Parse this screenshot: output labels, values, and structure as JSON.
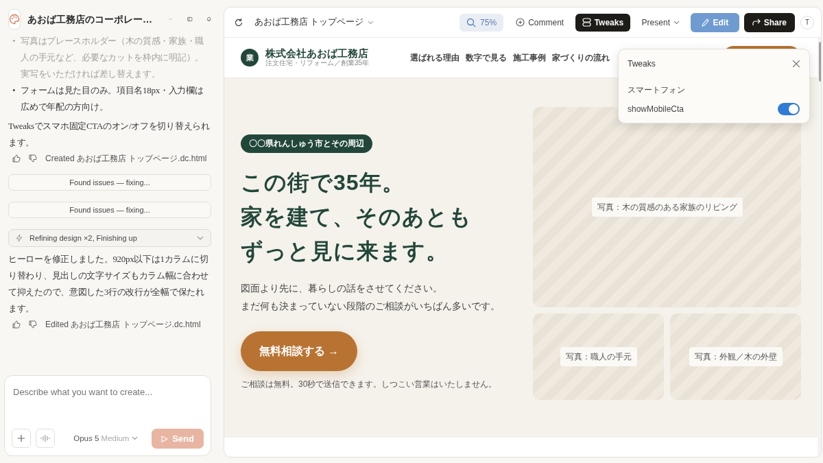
{
  "sidebar": {
    "project_title": "あおば工務店のコーポレー…",
    "messages": [
      {
        "kind": "bullets",
        "marker": "•",
        "items": [
          "写真はプレースホルダー（木の質感・家族・職人の手元など、必要なカットを枠内に明記）。実写をいただければ差し替えます。",
          "フォームは見た目のみ。項目名18px・入力欄は広めで年配の方向け。"
        ]
      },
      {
        "kind": "paragraph",
        "text": "Tweaksでスマホ固定CTAのオン/オフを切り替えられます。"
      },
      {
        "kind": "file",
        "text": "Created あおば工務店 トップページ.dc.html"
      },
      {
        "kind": "status",
        "text": "Found issues — fixing..."
      },
      {
        "kind": "status",
        "text": "Found issues — fixing..."
      },
      {
        "kind": "collapsible",
        "text": "Refining design ×2, Finishing up",
        "expanded": false
      },
      {
        "kind": "paragraph",
        "text": "ヒーローを修正しました。920px以下は1カラムに切り替わり、見出しの文字サイズもカラム幅に合わせて抑えたので、意図した3行の改行が全幅で保たれます。"
      },
      {
        "kind": "file",
        "text": "Edited あおば工務店 トップページ.dc.html"
      }
    ],
    "composer": {
      "placeholder": "Describe what you want to create...",
      "model": "Opus 5",
      "effort": "Medium",
      "send": "Send",
      "send_disabled": true
    }
  },
  "toolbar": {
    "page_title": "あおば工務店 トップページ",
    "zoom": "75%",
    "buttons": [
      {
        "kind": "comment",
        "label": "Comment"
      },
      {
        "kind": "tweaks",
        "label": "Tweaks",
        "selected": true
      },
      {
        "kind": "present",
        "label": "Present"
      },
      {
        "kind": "edit",
        "label": "Edit"
      },
      {
        "kind": "share",
        "label": "Share"
      }
    ],
    "avatar": "T"
  },
  "site": {
    "logo_mark": "業",
    "name": "株式会社あおば工務店",
    "tagline": "注文住宅・リフォーム／創業35年",
    "nav": [
      "選ばれる理由",
      "数字で見る",
      "施工事例",
      "家づくりの流れ"
    ],
    "hero": {
      "tag": "〇〇県れんしゅう市とその周辺",
      "headline": [
        "この街で35年。",
        "家を建て、そのあとも",
        "ずっと見に来ます。"
      ],
      "lead": [
        "図面より先に、暮らしの話をさせてください。",
        "まだ何も決まっていない段階のご相談がいちばん多いです。"
      ],
      "cta": "無料相談する →",
      "note": "ご相談は無料。30秒で送信できます。しつこい営業はいたしません。",
      "photos": [
        "写真：木の質感のある家族のリビング",
        "写真：職人の手元",
        "写真：外観／木の外壁"
      ]
    }
  },
  "tweaks_panel": {
    "title": "Tweaks",
    "section": "スマートフォン",
    "toggles": [
      {
        "label": "showMobileCta",
        "on": true
      }
    ]
  }
}
